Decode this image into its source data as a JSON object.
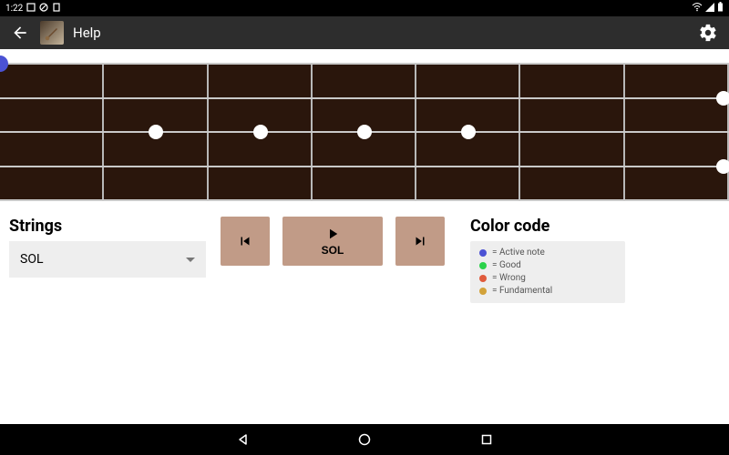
{
  "status": {
    "time": "1:22"
  },
  "appbar": {
    "title": "Help"
  },
  "stringsPanel": {
    "heading": "Strings",
    "selected": "SOL"
  },
  "playback": {
    "play_label": "SOL"
  },
  "legend": {
    "heading": "Color code",
    "items": [
      {
        "color": "#4b52d4",
        "label": "= Active note"
      },
      {
        "color": "#2bd24a",
        "label": "= Good"
      },
      {
        "color": "#e05b3c",
        "label": "= Wrong"
      },
      {
        "color": "#d2a23a",
        "label": "= Fundamental"
      }
    ]
  },
  "fretboard": {
    "strings": 4,
    "frets": 7,
    "markers": [
      {
        "fret": 2,
        "string": 2
      },
      {
        "fret": 3,
        "string": 2
      },
      {
        "fret": 4,
        "string": 2
      },
      {
        "fret": 5,
        "string": 2
      },
      {
        "fret": 7,
        "string": 1
      },
      {
        "fret": 7,
        "string": 3
      }
    ],
    "active": {
      "fret": 0,
      "string": 0
    }
  },
  "colors": {
    "fret_bg": "#2a160c",
    "btn_bg": "#c19b87"
  }
}
